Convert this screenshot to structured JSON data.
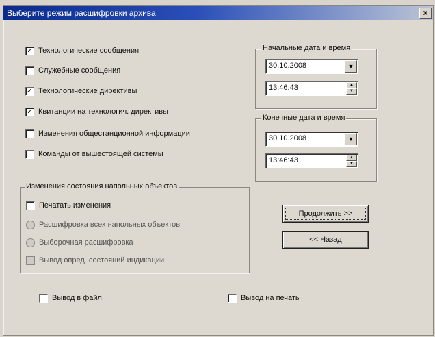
{
  "window": {
    "title": "Выберите режим расшифровки архива",
    "close_label": "×"
  },
  "message_options": [
    {
      "label": "Технологические сообщения",
      "checked": true
    },
    {
      "label": "Служебные сообщения",
      "checked": false
    },
    {
      "label": "Технологические директивы",
      "checked": true
    },
    {
      "label": "Квитанции на технологич. директивы",
      "checked": true
    },
    {
      "label": "Изменения общестанционной информации",
      "checked": false
    },
    {
      "label": "Команды от вышестоящей системы",
      "checked": false
    }
  ],
  "start": {
    "group_title": "Начальные дата и время",
    "date": "30.10.2008",
    "time": "13:46:43"
  },
  "end": {
    "group_title": "Конечные дата и время",
    "date": "30.10.2008",
    "time": "13:46:43"
  },
  "objects": {
    "group_title": "Изменения состояния напольных объектов",
    "print_changes": {
      "label": "Печатать изменения",
      "checked": false
    },
    "decode_all": {
      "label": "Расшифровка всех напольных объектов"
    },
    "decode_selective": {
      "label": "Выборочная расшифровка"
    },
    "output_states": {
      "label": "Вывод опред. состояний индикации"
    }
  },
  "buttons": {
    "continue": "Продолжить >>",
    "back": "<< Назад"
  },
  "output": {
    "to_file": {
      "label": "Вывод в файл",
      "checked": false
    },
    "to_print": {
      "label": "Вывод на печать",
      "checked": false
    }
  },
  "icons": {
    "dropdown_arrow": "▼",
    "spin_up": "▲",
    "spin_down": "▼",
    "check_mark": "✓"
  }
}
